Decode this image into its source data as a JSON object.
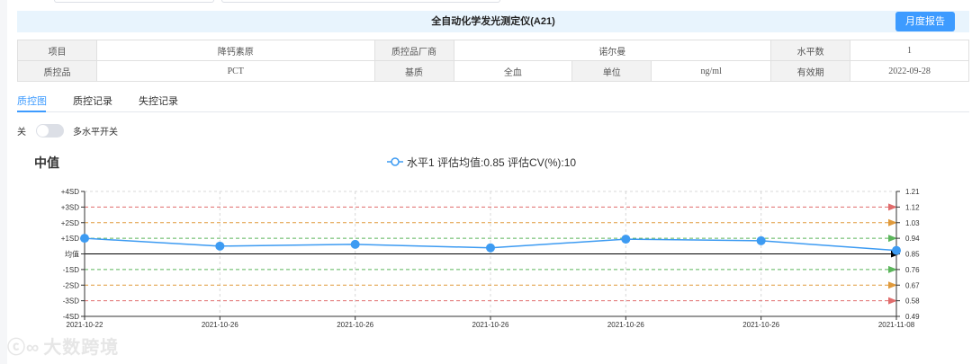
{
  "window": {
    "title": "全自动化学发光测定仪(A21)",
    "report_button": "月度报告"
  },
  "info": {
    "row1": [
      {
        "label": "项目",
        "value": "降钙素原"
      },
      {
        "label": "质控品厂商",
        "value": "诺尔曼"
      },
      {
        "label": "水平数",
        "value": "1"
      }
    ],
    "row2": [
      {
        "label": "质控品",
        "value": "PCT"
      },
      {
        "label": "基质",
        "value": "全血"
      },
      {
        "label": "单位",
        "value": "ng/ml"
      },
      {
        "label": "有效期",
        "value": "2022-09-28"
      }
    ]
  },
  "tabs": [
    {
      "label": "质控图",
      "active": true
    },
    {
      "label": "质控记录",
      "active": false
    },
    {
      "label": "失控记录",
      "active": false
    }
  ],
  "multi_level": {
    "state_label": "关",
    "label": "多水平开关",
    "on": false
  },
  "chart_title": "中值",
  "watermark": "大数跨境",
  "chart_data": {
    "type": "line",
    "title": "中值",
    "legend": "水平1 评估均值:0.85 评估CV(%):10",
    "legend_position": "top-center",
    "x": [
      "2021-10-22",
      "2021-10-26",
      "2021-10-26",
      "2021-10-26",
      "2021-10-26",
      "2021-10-26",
      "2021-11-08"
    ],
    "series": [
      {
        "name": "水平1",
        "values": [
          0.94,
          0.895,
          0.905,
          0.885,
          0.935,
          0.926,
          0.87
        ],
        "color": "#3d9bf2"
      }
    ],
    "ylim": [
      0.49,
      1.21
    ],
    "y_left_ticks": [
      "+4SD",
      "+3SD",
      "+2SD",
      "+1SD",
      "均值",
      "-1SD",
      "-2SD",
      "-3SD",
      "-4SD"
    ],
    "y_right_ticks": [
      "1.21",
      "1.12",
      "1.03",
      "0.94",
      "0.85",
      "0.76",
      "0.67",
      "0.58",
      "0.49"
    ],
    "reference_line_colors": [
      "#bbbbbb",
      "#e06c6c",
      "#e09a3c",
      "#5bb55b",
      "#000000",
      "#5bb55b",
      "#e09a3c",
      "#e06c6c",
      "#bbbbbb"
    ],
    "grid": true
  }
}
